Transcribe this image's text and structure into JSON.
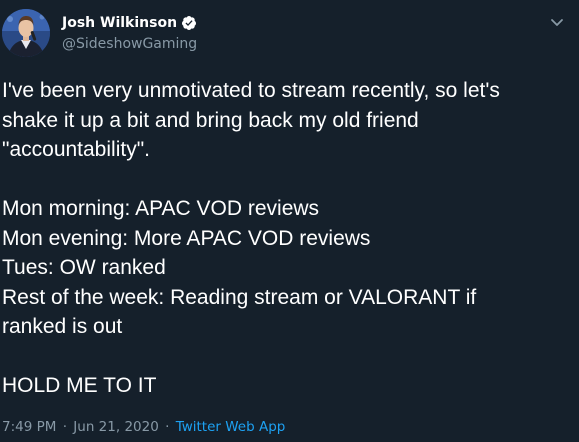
{
  "author": {
    "display_name": "Josh Wilkinson",
    "handle": "@SideshowGaming",
    "verified": true
  },
  "tweet": {
    "lines_paragraph_1": [
      "I've been very unmotivated to stream recently, so let's",
      "shake it up a bit and bring back my old friend",
      "\"accountability\"."
    ],
    "lines_paragraph_2": [
      "Mon morning: APAC VOD reviews",
      "Mon evening: More APAC VOD reviews",
      "Tues: OW ranked",
      "Rest of the week: Reading stream or VALORANT if",
      "ranked is out"
    ],
    "lines_paragraph_3": [
      "HOLD ME TO IT"
    ],
    "time": "7:49 PM",
    "date": "Jun 21, 2020",
    "separator": "·",
    "source": "Twitter Web App"
  },
  "icons": {
    "verified": "verified-badge-icon",
    "more": "chevron-down-icon"
  },
  "colors": {
    "background": "#15202b",
    "text": "#ffffff",
    "secondary_text": "#8899a6",
    "accent": "#1da1f2"
  }
}
